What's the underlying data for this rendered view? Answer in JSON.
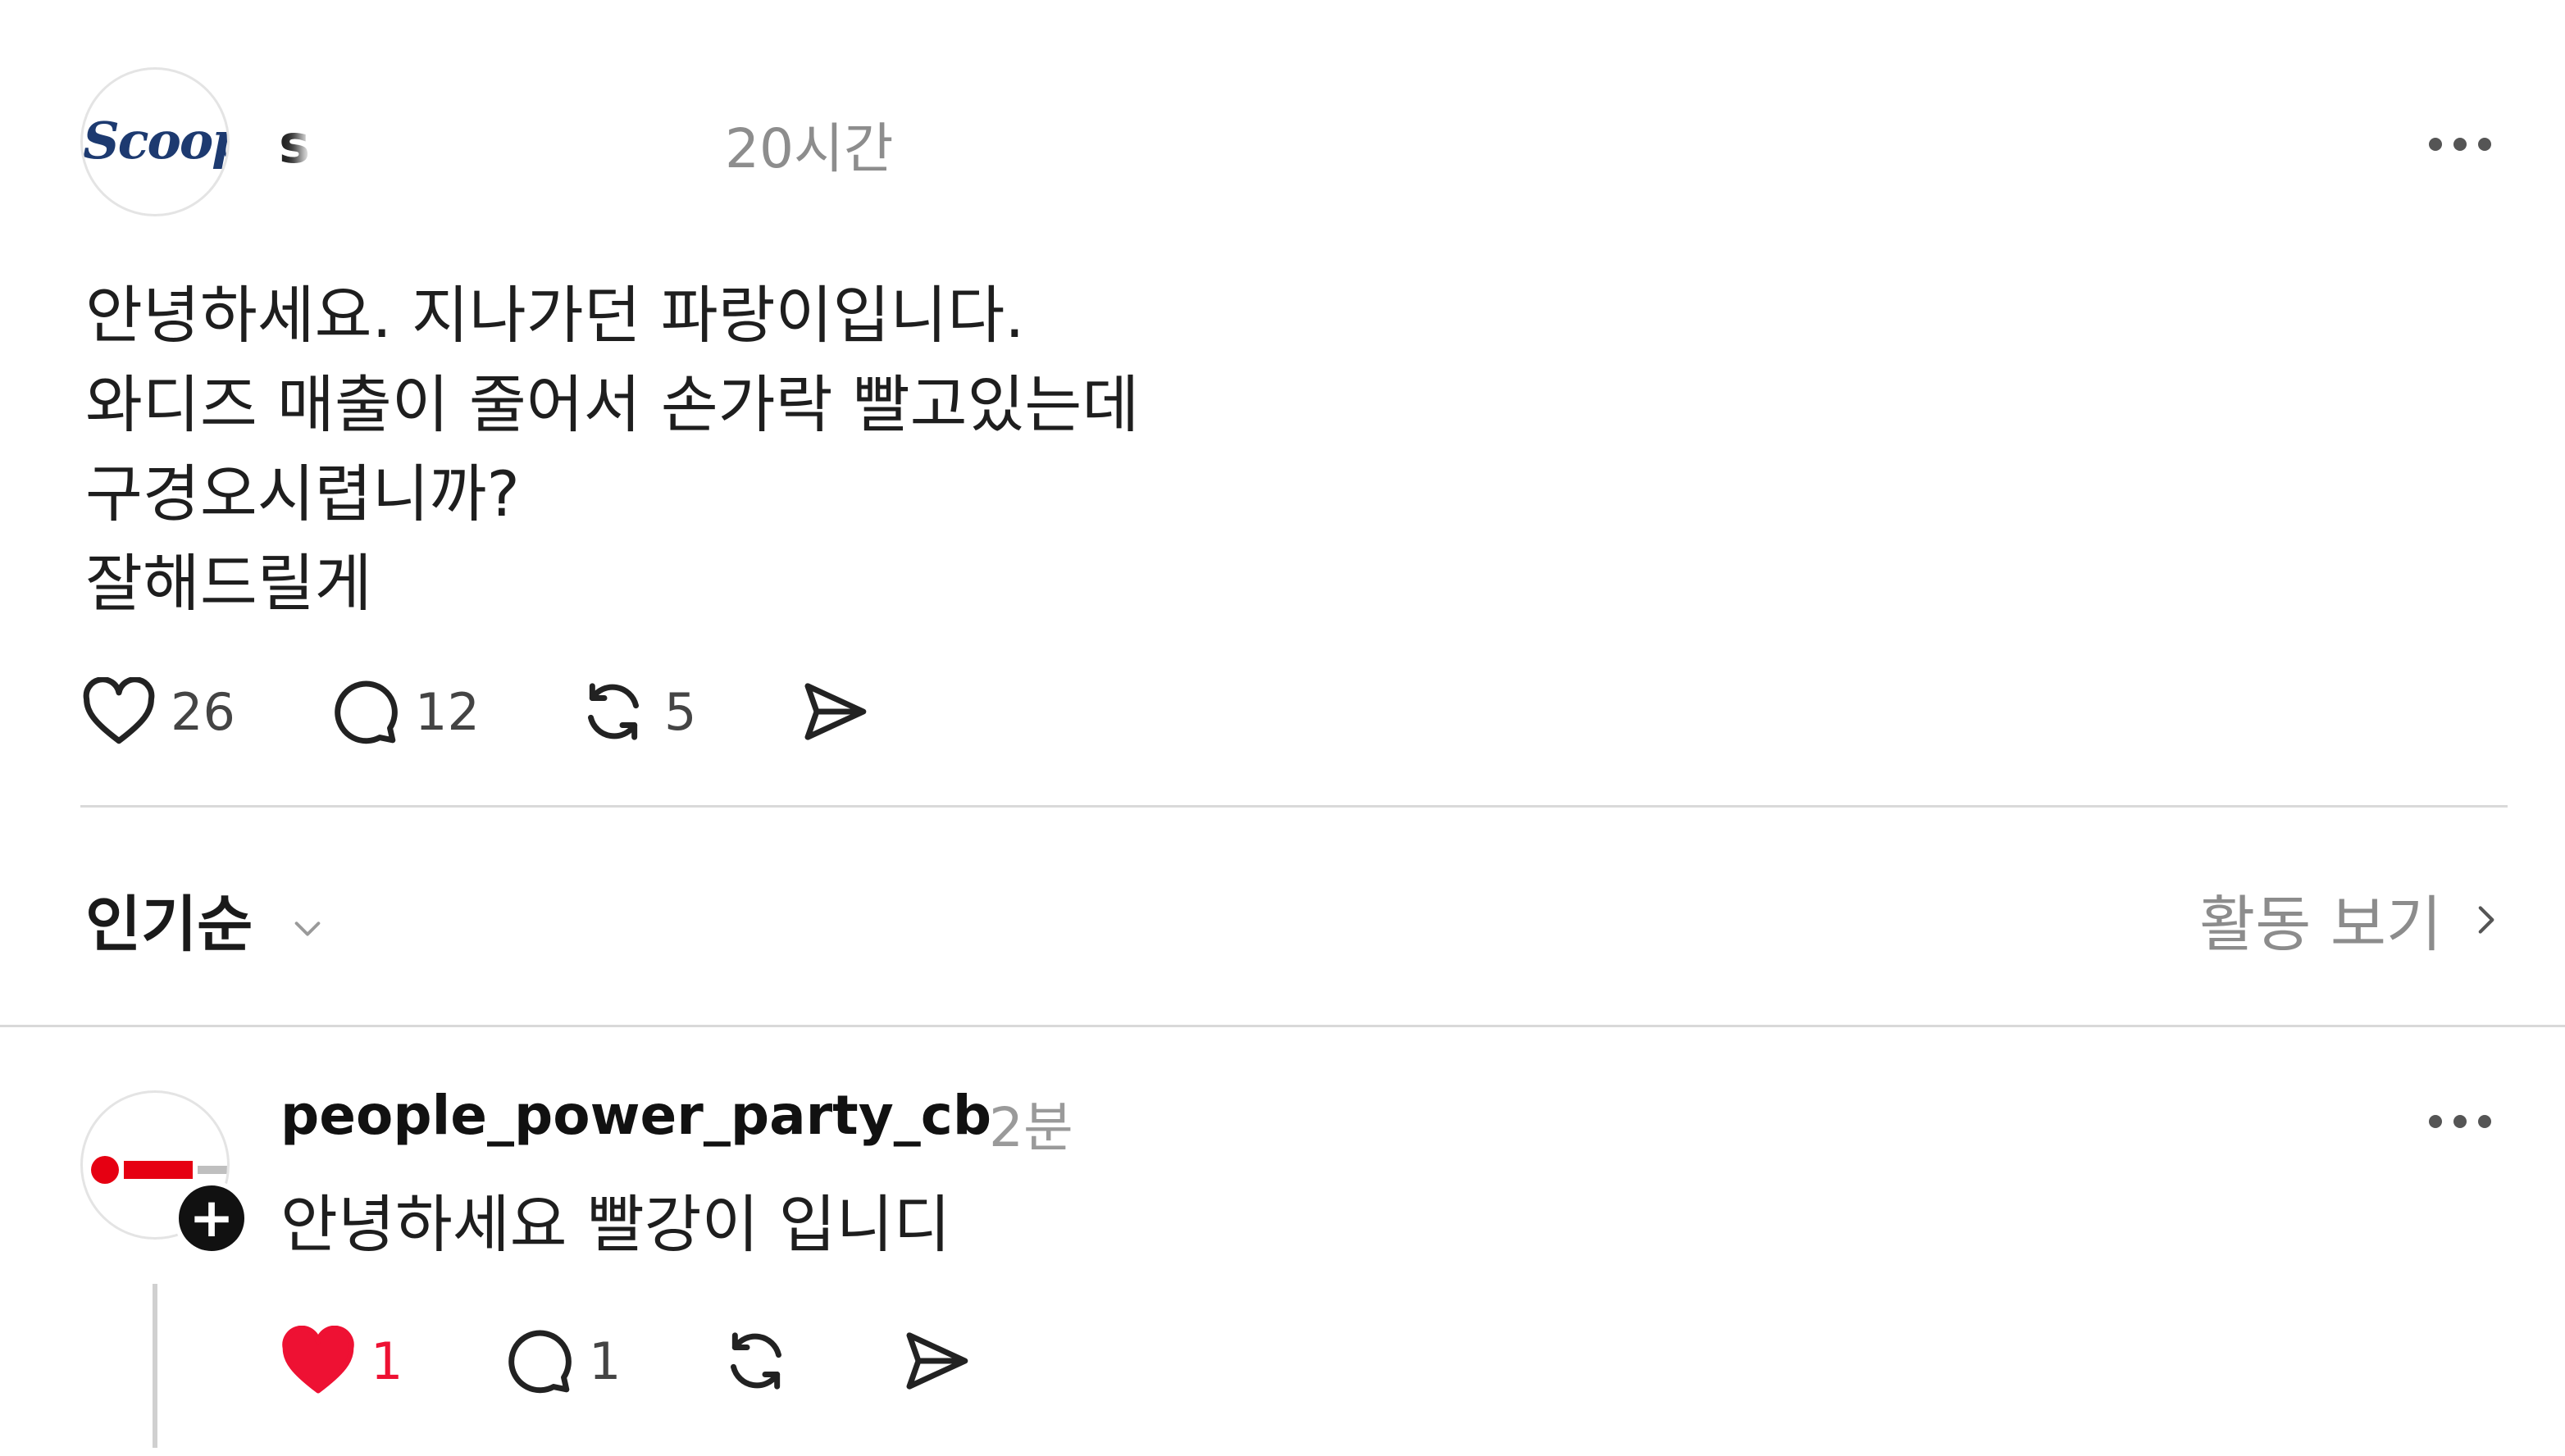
{
  "post": {
    "author": {
      "avatar_logo_text": "Scoop",
      "username_visible": "sc",
      "username_note": "redacted"
    },
    "time": "20시간",
    "body_lines": [
      "안녕하세요. 지나가던 파랑이입니다.",
      "와디즈 매출이 줄어서 손가락 빨고있는데",
      "구경오시렵니까?",
      "잘해드릴게"
    ],
    "stats": {
      "likes": "26",
      "comments": "12",
      "reposts": "5"
    }
  },
  "sort": {
    "label": "인기순"
  },
  "activity": {
    "label": "활동 보기"
  },
  "reply": {
    "username": "people_power_party_cb",
    "time": "2분",
    "text": "안녕하세요 빨강이 입니디",
    "stats": {
      "likes": "1",
      "comments": "1"
    }
  },
  "colors": {
    "like_active": "#ee1133",
    "muted_text": "#8c8c8c",
    "divider": "#d9d9d9",
    "scoop_brand": "#1d3a70",
    "ppp_brand": "#e60012"
  },
  "icons": {
    "like": "heart-icon",
    "comment": "speech-bubble-icon",
    "repost": "repost-arrows-icon",
    "share": "paper-plane-icon",
    "more": "more-dots-icon",
    "chevron_down": "chevron-down-icon",
    "chevron_right": "chevron-right-icon",
    "follow": "plus-icon"
  }
}
